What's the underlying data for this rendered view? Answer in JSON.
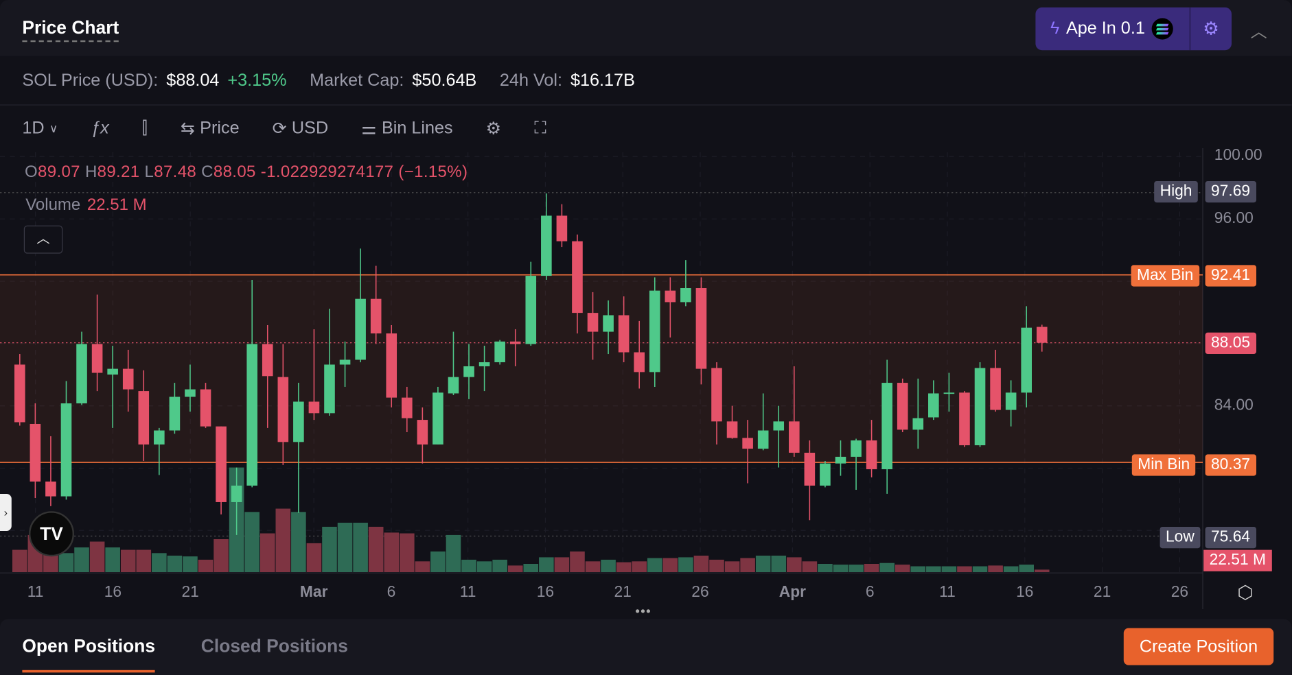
{
  "header": {
    "title": "Price Chart",
    "ape_label": "Ape In 0.1",
    "icons": [
      "lightning-icon",
      "solana-icon",
      "gear-icon",
      "chevron-up-icon"
    ]
  },
  "stats": {
    "price_label": "SOL Price (USD):",
    "price": "$88.04",
    "change": "+3.15%",
    "mcap_label": "Market Cap:",
    "mcap": "$50.64B",
    "vol_label": "24h Vol:",
    "vol": "$16.17B"
  },
  "toolbar": {
    "interval": "1D",
    "price": "Price",
    "currency": "USD",
    "bin_lines": "Bin Lines"
  },
  "legend": {
    "o_k": "O",
    "o": "89.07",
    "h_k": "H",
    "h": "89.21",
    "l_k": "L",
    "l": "87.48",
    "c_k": "C",
    "c": "88.05",
    "change": "-1.022929274177 (−1.15%)",
    "volume_label": "Volume",
    "volume": "22.51 M"
  },
  "price_labels": {
    "high_label": "High",
    "high": "97.69",
    "max_label": "Max Bin",
    "max": "92.41",
    "current": "88.05",
    "min_label": "Min Bin",
    "min": "80.37",
    "low_label": "Low",
    "low": "75.64",
    "volume": "22.51 M"
  },
  "colors": {
    "up": "#4fc98a",
    "down": "#e5536a",
    "bin": "#f0703a",
    "accent": "#e8622c",
    "ape": "#3a2b7c"
  },
  "chart_data": {
    "type": "candlestick",
    "y_ticks": [
      "100.00",
      "96.00",
      "84.00"
    ],
    "x_ticks": [
      "11",
      "16",
      "21",
      "Mar",
      "6",
      "11",
      "16",
      "21",
      "26",
      "Apr",
      "6",
      "11",
      "16",
      "21",
      "26"
    ],
    "bins": {
      "max": 92.41,
      "min": 80.37
    },
    "high": 97.69,
    "low": 75.64,
    "last": 88.05,
    "ohlc": [
      [
        86.65,
        87.33,
        82.73,
        82.95
      ],
      [
        82.84,
        84.16,
        78.08,
        79.14
      ],
      [
        79.14,
        82.05,
        77.56,
        78.19
      ],
      [
        78.19,
        85.59,
        77.98,
        84.16
      ],
      [
        84.16,
        88.76,
        84.06,
        87.97
      ],
      [
        87.97,
        91.14,
        84.95,
        86.12
      ],
      [
        86.01,
        87.86,
        82.58,
        86.38
      ],
      [
        86.38,
        87.6,
        83.63,
        85.06
      ],
      [
        84.95,
        86.28,
        80.46,
        81.52
      ],
      [
        81.52,
        82.58,
        79.56,
        82.42
      ],
      [
        82.42,
        85.48,
        82.21,
        84.58
      ],
      [
        84.58,
        86.65,
        83.63,
        85.06
      ],
      [
        85.06,
        85.48,
        82.58,
        82.68
      ],
      [
        82.68,
        82.68,
        77.03,
        77.82
      ],
      [
        77.82,
        80.04,
        75.71,
        78.88
      ],
      [
        78.88,
        92.09,
        78.77,
        87.97
      ],
      [
        87.97,
        89.18,
        82.58,
        85.91
      ],
      [
        85.85,
        87.97,
        80.2,
        81.68
      ],
      [
        81.68,
        85.48,
        77.13,
        84.27
      ],
      [
        84.27,
        88.92,
        83.1,
        83.53
      ],
      [
        83.53,
        90.24,
        83.37,
        86.65
      ],
      [
        86.65,
        88.13,
        85.22,
        86.96
      ],
      [
        86.96,
        94.1,
        86.8,
        90.87
      ],
      [
        90.87,
        92.99,
        87.97,
        88.65
      ],
      [
        88.65,
        89.18,
        83.9,
        84.53
      ],
      [
        84.53,
        85.22,
        82.31,
        83.21
      ],
      [
        83.1,
        83.9,
        80.3,
        81.52
      ],
      [
        81.52,
        85.22,
        81.52,
        84.85
      ],
      [
        84.8,
        88.76,
        84.69,
        85.85
      ],
      [
        85.85,
        87.97,
        84.43,
        86.54
      ],
      [
        86.54,
        87.86,
        84.95,
        86.8
      ],
      [
        86.8,
        88.23,
        86.65,
        88.13
      ],
      [
        88.13,
        88.92,
        86.54,
        87.97
      ],
      [
        87.97,
        93.25,
        87.86,
        92.35
      ],
      [
        92.35,
        97.64,
        92.09,
        96.21
      ],
      [
        96.21,
        96.95,
        94.2,
        94.57
      ],
      [
        94.57,
        95.0,
        88.65,
        89.97
      ],
      [
        89.97,
        91.3,
        86.96,
        88.76
      ],
      [
        88.76,
        90.77,
        87.33,
        89.82
      ],
      [
        89.82,
        91.03,
        86.8,
        87.44
      ],
      [
        87.44,
        89.45,
        85.11,
        86.17
      ],
      [
        86.17,
        92.25,
        85.22,
        91.4
      ],
      [
        91.4,
        92.25,
        88.39,
        90.66
      ],
      [
        90.66,
        93.36,
        90.4,
        91.56
      ],
      [
        91.56,
        92.25,
        85.38,
        86.38
      ],
      [
        86.43,
        86.8,
        81.52,
        83.0
      ],
      [
        83.0,
        84.0,
        81.89,
        81.94
      ],
      [
        81.94,
        83.1,
        79.03,
        81.25
      ],
      [
        81.25,
        84.8,
        81.15,
        82.42
      ],
      [
        82.42,
        84.0,
        80.04,
        83.0
      ],
      [
        83.0,
        86.54,
        80.73,
        80.99
      ],
      [
        80.99,
        81.78,
        76.66,
        78.88
      ],
      [
        78.88,
        80.46,
        78.77,
        80.3
      ],
      [
        80.3,
        81.78,
        79.51,
        80.73
      ],
      [
        80.73,
        81.89,
        78.61,
        81.78
      ],
      [
        81.78,
        83.1,
        79.41,
        79.93
      ],
      [
        79.93,
        86.96,
        78.35,
        85.48
      ],
      [
        85.48,
        85.75,
        82.31,
        82.47
      ],
      [
        82.47,
        85.75,
        81.25,
        83.21
      ],
      [
        83.26,
        85.64,
        83.1,
        84.8
      ],
      [
        84.8,
        86.12,
        83.63,
        84.85
      ],
      [
        84.85,
        84.95,
        81.36,
        81.47
      ],
      [
        81.47,
        86.8,
        81.36,
        86.43
      ],
      [
        86.43,
        87.6,
        83.63,
        83.74
      ],
      [
        83.74,
        85.64,
        82.68,
        84.85
      ],
      [
        84.85,
        90.4,
        83.9,
        89.02
      ],
      [
        89.07,
        89.21,
        87.48,
        88.05
      ]
    ],
    "volume_m": [
      203,
      338,
      173,
      173,
      225,
      278,
      225,
      203,
      203,
      173,
      150,
      143,
      113,
      300,
      953,
      548,
      353,
      578,
      548,
      263,
      413,
      450,
      450,
      413,
      360,
      353,
      98,
      188,
      338,
      113,
      98,
      113,
      60,
      75,
      135,
      135,
      188,
      98,
      113,
      90,
      98,
      128,
      128,
      135,
      150,
      113,
      98,
      128,
      150,
      150,
      135,
      98,
      75,
      68,
      68,
      75,
      83,
      68,
      53,
      53,
      53,
      53,
      53,
      60,
      53,
      68,
      22.51
    ]
  },
  "bottom": {
    "tab_open": "Open Positions",
    "tab_closed": "Closed Positions",
    "create": "Create Position"
  }
}
